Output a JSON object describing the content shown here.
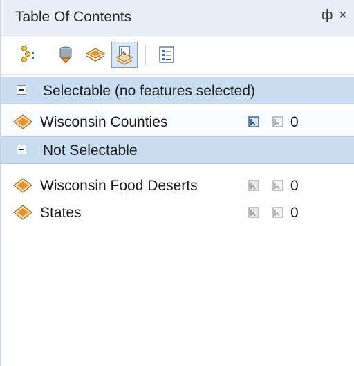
{
  "panel": {
    "title": "Table Of Contents",
    "pin_glyph": "ф",
    "close_glyph": "×"
  },
  "toolbar": {
    "buttons": [
      {
        "icon": "list-by-drawing-order-icon",
        "active": false
      },
      {
        "icon": "list-by-source-icon",
        "active": false
      },
      {
        "icon": "list-by-visibility-icon",
        "active": false
      },
      {
        "icon": "list-by-selection-icon",
        "active": true
      },
      {
        "icon": "options-icon",
        "active": false
      }
    ]
  },
  "groups": [
    {
      "label": "Selectable (no features selected)",
      "layers": [
        {
          "name": "Wisconsin Counties",
          "count": "0",
          "selectable": true
        }
      ]
    },
    {
      "label": "Not Selectable",
      "layers": [
        {
          "name": "Wisconsin Food Deserts",
          "count": "0",
          "selectable": false
        },
        {
          "name": "States",
          "count": "0",
          "selectable": false
        }
      ]
    }
  ],
  "colors": {
    "header_bg": "#c8dcf2",
    "title_bg": "#e8eef6",
    "active_button": "#d9e8f7",
    "layer_icon_orange": "#e8902a",
    "layer_icon_tan": "#f3d9a8"
  }
}
